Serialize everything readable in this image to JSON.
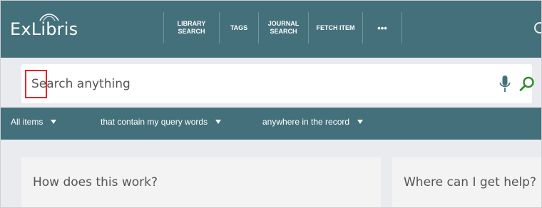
{
  "app": {
    "logo_text": "ExLibris"
  },
  "nav": {
    "items": [
      {
        "line1": "LIBRARY",
        "line2": "SEARCH"
      },
      {
        "line1": "TAGS",
        "line2": ""
      },
      {
        "line1": "JOURNAL",
        "line2": "SEARCH"
      },
      {
        "line1": "FETCH ITEM",
        "line2": ""
      },
      {
        "line1": "•••",
        "line2": ""
      }
    ]
  },
  "search": {
    "placeholder": "Search anything",
    "value": ""
  },
  "filters": {
    "scope": "All items",
    "match": "that contain my query words",
    "field": "anywhere in the record"
  },
  "cards": {
    "how_title": "How does this work?",
    "help_title": "Where can I get help?"
  },
  "colors": {
    "brand": "#44707b",
    "highlight": "#e0262b",
    "search_icon": "#2e8b2e",
    "mic_icon": "#44707b"
  },
  "icons": {
    "mic": "microphone-icon",
    "search": "search-icon",
    "more": "more-icon",
    "caret": "caret-down-icon"
  }
}
